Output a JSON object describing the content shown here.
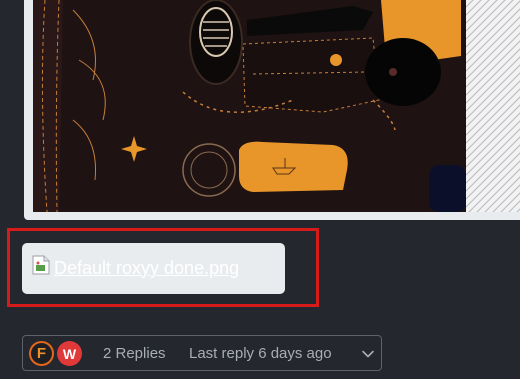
{
  "attachment": {
    "filename": "Default roxyy done.png"
  },
  "replies": {
    "avatars": [
      {
        "letter": "F",
        "color": "#e5671b"
      },
      {
        "letter": "W",
        "color": "#e0393a"
      }
    ],
    "count_label": "2 Replies",
    "last_reply_label": "Last reply 6 days ago"
  },
  "colors": {
    "background": "#24272d",
    "highlight": "#d71a1a",
    "card": "#e9ecef"
  },
  "icons": {
    "broken_image": "broken-image-icon",
    "expand": "chevron-down-icon"
  }
}
